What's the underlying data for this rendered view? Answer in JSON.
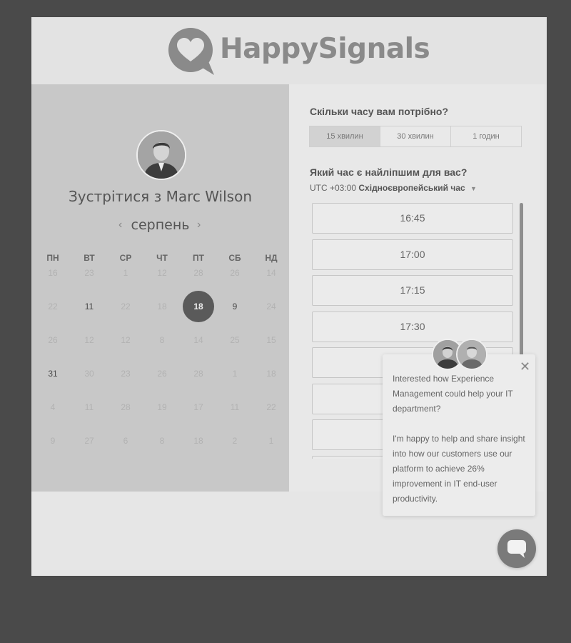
{
  "brand": {
    "name": "HappySignals",
    "logo_icon": "heart-speech-bubble-icon",
    "color": "#8a8a8a"
  },
  "host": {
    "title": "Зустрітися з Marc Wilson",
    "avatar_icon": "person-avatar"
  },
  "calendar": {
    "prev_icon": "chevron-left-icon",
    "next_icon": "chevron-right-icon",
    "month": "серпень",
    "weekdays": [
      "ПН",
      "ВТ",
      "СР",
      "ЧТ",
      "ПТ",
      "СБ",
      "НД"
    ],
    "weeks": [
      [
        "16",
        "23",
        "1",
        "12",
        "28",
        "26",
        "14"
      ],
      [
        "22",
        "11",
        "22",
        "18",
        "18",
        "9",
        "24"
      ],
      [
        "26",
        "12",
        "12",
        "8",
        "14",
        "25",
        "15"
      ],
      [
        "31",
        "30",
        "23",
        "26",
        "28",
        "1",
        "18"
      ],
      [
        "4",
        "11",
        "28",
        "19",
        "17",
        "11",
        "22"
      ],
      [
        "9",
        "27",
        "6",
        "8",
        "18",
        "2",
        "1"
      ]
    ],
    "available": [
      [
        1,
        1
      ],
      [
        1,
        4
      ],
      [
        1,
        5
      ],
      [
        3,
        0
      ]
    ],
    "selected": [
      1,
      4
    ]
  },
  "duration": {
    "question": "Скільки часу вам потрібно?",
    "options": [
      "15 хвилин",
      "30 хвилин",
      "1 годин"
    ],
    "active_index": 0
  },
  "time": {
    "question": "Який час є найліпшим для вас?",
    "tz_offset": "UTC +03:00",
    "tz_name": "Східноєвропейський час",
    "caret_icon": "caret-down-icon",
    "slots": [
      "16:45",
      "17:00",
      "17:15",
      "17:30",
      "",
      "",
      "",
      ""
    ]
  },
  "chat_popup": {
    "message": "Interested how Experience Management could help your IT department?\n\nI'm happy to help and share insight into how our customers use our platform to achieve 26% improvement in IT end-user productivity.",
    "close_icon": "close-icon",
    "avatars": [
      "person-avatar",
      "person-avatar"
    ]
  },
  "chat_button": {
    "icon": "chat-bubble-icon"
  }
}
